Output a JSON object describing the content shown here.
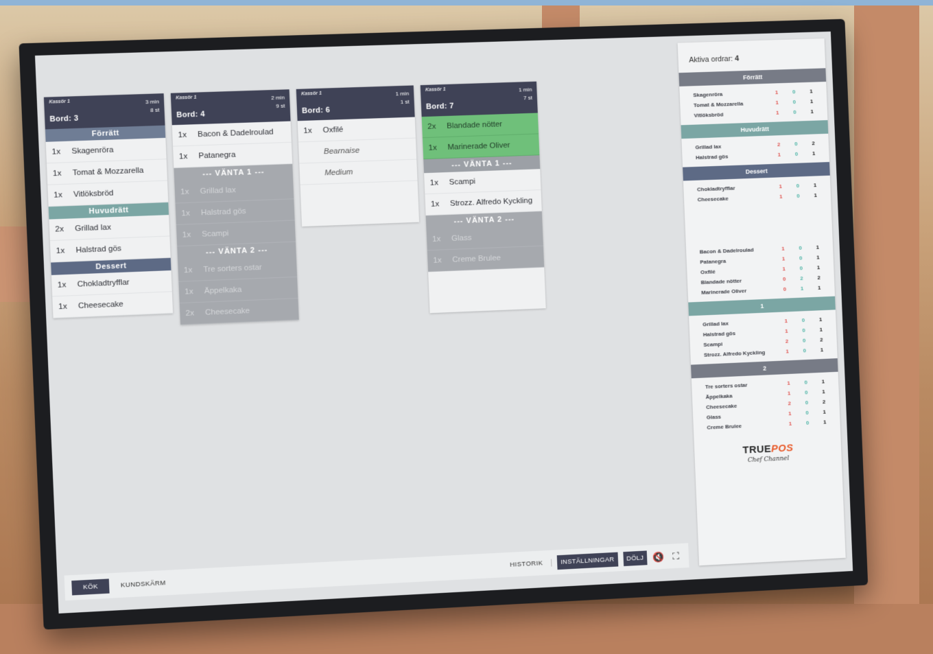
{
  "orders": [
    {
      "cashier": "Kassör 1",
      "table": "Bord: 3",
      "time": "3 min",
      "count": "8 st",
      "sections": [
        {
          "kind": "course",
          "label": "Förrätt",
          "style": "forratt"
        },
        {
          "kind": "item",
          "qty": "1x",
          "name": "Skagenröra"
        },
        {
          "kind": "item",
          "qty": "1x",
          "name": "Tomat & Mozzarella"
        },
        {
          "kind": "item",
          "qty": "1x",
          "name": "Vitlöksbröd"
        },
        {
          "kind": "course",
          "label": "Huvudrätt",
          "style": "huvud"
        },
        {
          "kind": "item",
          "qty": "2x",
          "name": "Grillad lax"
        },
        {
          "kind": "item",
          "qty": "1x",
          "name": "Halstrad gös"
        },
        {
          "kind": "course",
          "label": "Dessert",
          "style": "dessert"
        },
        {
          "kind": "item",
          "qty": "1x",
          "name": "Chokladtryfflar"
        },
        {
          "kind": "item",
          "qty": "1x",
          "name": "Cheesecake"
        }
      ]
    },
    {
      "cashier": "Kassör 1",
      "table": "Bord: 4",
      "time": "2 min",
      "count": "9 st",
      "sections": [
        {
          "kind": "item",
          "qty": "1x",
          "name": "Bacon & Dadelroulad"
        },
        {
          "kind": "item",
          "qty": "1x",
          "name": "Patanegra"
        },
        {
          "kind": "wait",
          "label": "--- VÄNTA 1 ---",
          "dim": true
        },
        {
          "kind": "item",
          "qty": "1x",
          "name": "Grillad lax",
          "dim": true
        },
        {
          "kind": "item",
          "qty": "1x",
          "name": "Halstrad gös",
          "dim": true
        },
        {
          "kind": "item",
          "qty": "1x",
          "name": "Scampi",
          "dim": true
        },
        {
          "kind": "wait",
          "label": "--- VÄNTA 2 ---",
          "dim": true
        },
        {
          "kind": "item",
          "qty": "1x",
          "name": "Tre sorters ostar",
          "dim": true
        },
        {
          "kind": "item",
          "qty": "1x",
          "name": "Äppelkaka",
          "dim": true
        },
        {
          "kind": "item",
          "qty": "2x",
          "name": "Cheesecake",
          "dim": true
        }
      ]
    },
    {
      "cashier": "Kassör 1",
      "table": "Bord: 6",
      "time": "1 min",
      "count": "1 st",
      "sections": [
        {
          "kind": "item",
          "qty": "1x",
          "name": "Oxfilé"
        },
        {
          "kind": "note",
          "text": "Bearnaise"
        },
        {
          "kind": "note",
          "text": "Medium"
        },
        {
          "kind": "spacer"
        }
      ]
    },
    {
      "cashier": "Kassör 1",
      "table": "Bord: 7",
      "time": "1 min",
      "count": "7 st",
      "sections": [
        {
          "kind": "item",
          "qty": "2x",
          "name": "Blandade nötter",
          "ready": true
        },
        {
          "kind": "item",
          "qty": "1x",
          "name": "Marinerade Oliver",
          "ready": true
        },
        {
          "kind": "wait",
          "label": "--- VÄNTA 1 ---",
          "dim": false
        },
        {
          "kind": "item",
          "qty": "1x",
          "name": "Scampi"
        },
        {
          "kind": "item",
          "qty": "1x",
          "name": "Strozz. Alfredo Kyckling"
        },
        {
          "kind": "wait",
          "label": "--- VÄNTA 2 ---",
          "dim": true
        },
        {
          "kind": "item",
          "qty": "1x",
          "name": "Glass",
          "dim": true
        },
        {
          "kind": "item",
          "qty": "1x",
          "name": "Creme Brulee",
          "dim": true
        },
        {
          "kind": "spacer"
        }
      ]
    }
  ],
  "sidebar": {
    "active_label": "Aktiva ordrar:",
    "active_count": "4",
    "groups": [
      {
        "title": "Förrätt",
        "style": "gray",
        "rows": [
          {
            "name": "Skagenröra",
            "a": "1",
            "b": "0",
            "c": "1"
          },
          {
            "name": "Tomat & Mozzarella",
            "a": "1",
            "b": "0",
            "c": "1"
          },
          {
            "name": "Vitlöksbröd",
            "a": "1",
            "b": "0",
            "c": "1"
          }
        ]
      },
      {
        "title": "Huvudrätt",
        "style": "teal",
        "rows": [
          {
            "name": "Grillad lax",
            "a": "2",
            "b": "0",
            "c": "2"
          },
          {
            "name": "Halstrad gös",
            "a": "1",
            "b": "0",
            "c": "1"
          }
        ]
      },
      {
        "title": "Dessert",
        "style": "navy",
        "rows": [
          {
            "name": "Chokladtryfflar",
            "a": "1",
            "b": "0",
            "c": "1"
          },
          {
            "name": "Cheesecake",
            "a": "1",
            "b": "0",
            "c": "1"
          }
        ]
      },
      {
        "title": "",
        "style": "none",
        "rows": [
          {
            "name": "Bacon & Dadelroulad",
            "a": "1",
            "b": "0",
            "c": "1"
          },
          {
            "name": "Patanegra",
            "a": "1",
            "b": "0",
            "c": "1"
          },
          {
            "name": "Oxfilé",
            "a": "1",
            "b": "0",
            "c": "1"
          },
          {
            "name": "Blandade nötter",
            "a": "0",
            "b": "2",
            "c": "2"
          },
          {
            "name": "Marinerade Oliver",
            "a": "0",
            "b": "1",
            "c": "1"
          }
        ]
      },
      {
        "title": "1",
        "style": "teal",
        "rows": [
          {
            "name": "Grillad lax",
            "a": "1",
            "b": "0",
            "c": "1"
          },
          {
            "name": "Halstrad gös",
            "a": "1",
            "b": "0",
            "c": "1"
          },
          {
            "name": "Scampi",
            "a": "2",
            "b": "0",
            "c": "2"
          },
          {
            "name": "Strozz. Alfredo Kyckling",
            "a": "1",
            "b": "0",
            "c": "1"
          }
        ]
      },
      {
        "title": "2",
        "style": "gray",
        "rows": [
          {
            "name": "Tre sorters ostar",
            "a": "1",
            "b": "0",
            "c": "1"
          },
          {
            "name": "Äppelkaka",
            "a": "1",
            "b": "0",
            "c": "1"
          },
          {
            "name": "Cheesecake",
            "a": "2",
            "b": "0",
            "c": "2"
          },
          {
            "name": "Glass",
            "a": "1",
            "b": "0",
            "c": "1"
          },
          {
            "name": "Creme Brulee",
            "a": "1",
            "b": "0",
            "c": "1"
          }
        ]
      }
    ],
    "brand_true": "TRUE",
    "brand_pos": "POS",
    "brand_sub": "Chef Channel"
  },
  "bottom": {
    "tab_kok": "KÖK",
    "tab_kundskarm": "KUNDSKÄRM",
    "historik": "HISTORIK",
    "installningar": "INSTÄLLNINGAR",
    "dolj": "DÖLJ",
    "mute_icon": "🔇",
    "fullscreen_icon": "⛶"
  },
  "colors": {
    "header": "#3f4256",
    "forratt": "#6f7d95",
    "huvud": "#7ba6a4",
    "dessert": "#5d6a85",
    "ready": "#6fc07a"
  }
}
